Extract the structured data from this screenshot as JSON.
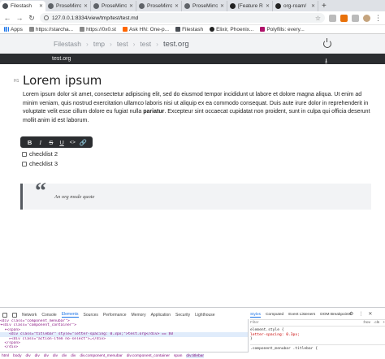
{
  "browser": {
    "tabs": [
      {
        "label": "Filestash",
        "active": true,
        "icon": "filestash-icon"
      },
      {
        "label": "ProseMirror",
        "active": false,
        "icon": "prosemirror-icon"
      },
      {
        "label": "ProseMirror",
        "active": false,
        "icon": "prosemirror-icon"
      },
      {
        "label": "ProseMirror",
        "active": false,
        "icon": "prosemirror-icon"
      },
      {
        "label": "ProseMirror",
        "active": false,
        "icon": "prosemirror-icon"
      },
      {
        "label": "[Feature Re",
        "active": false,
        "icon": "github-icon"
      },
      {
        "label": "org-roam/",
        "active": false,
        "icon": "github-icon"
      }
    ],
    "url": "127.0.0.1:8334/view/tmp/test/test.md",
    "bookmarks": [
      {
        "label": "Apps",
        "icon": "apps-grid-icon"
      },
      {
        "label": "https://starcha...",
        "icon": "page-icon"
      },
      {
        "label": "https://0x0.st",
        "icon": "page-icon"
      },
      {
        "label": "Ask HN: One-p...",
        "icon": "hackernews-icon"
      },
      {
        "label": "Filestash",
        "icon": "filestash-icon"
      },
      {
        "label": "Elixir, Phoenix...",
        "icon": "github-icon"
      },
      {
        "label": "Polyfills: every...",
        "icon": "polyfill-icon"
      }
    ]
  },
  "app": {
    "breadcrumb": [
      "Filestash",
      "tmp",
      "test",
      "test"
    ],
    "breadcrumb_separator": "›",
    "current_file": "test.org",
    "editor_filename": "test.org",
    "download_glyph": "⭳"
  },
  "document": {
    "h1_tag": "H1",
    "title": "Lorem ipsum",
    "paragraph_pre": "Lorem ipsum dolor sit amet, consectetur adipiscing elit, sed do eiusmod tempor incididunt ut labore et dolore magna aliqua. Ut enim ad minim veniam, quis nostrud exercitation ullamco laboris nisi ut aliquip ex ea commodo consequat. Duis aute irure dolor in reprehenderit in voluptate velit esse cillum dolore eu fugiat nulla ",
    "paragraph_bold": "pariatur",
    "paragraph_post": ". Excepteur sint occaecat cupidatat non proident, sunt in culpa qui officia deserunt mollit anim id est laborum.",
    "menubar": [
      {
        "glyph": "B",
        "name": "bold-button",
        "style": "bold"
      },
      {
        "glyph": "I",
        "name": "italic-button",
        "style": "italic"
      },
      {
        "glyph": "S",
        "name": "strikethrough-button",
        "style": "strike"
      },
      {
        "glyph": "U",
        "name": "underline-button",
        "style": "under"
      },
      {
        "glyph": "<>",
        "name": "code-button",
        "style": "code"
      },
      {
        "glyph": "🔗",
        "name": "link-button",
        "style": ""
      }
    ],
    "checklist": [
      "checklist 2",
      "checklist 3"
    ],
    "quote_mark": "“",
    "quote": "An org mode quote"
  },
  "devtools": {
    "tabs": [
      "Network",
      "Console",
      "Elements",
      "Sources",
      "Performance",
      "Memory",
      "Application",
      "Security",
      "Lighthouse"
    ],
    "active_tab": "Elements",
    "dom_lines": [
      "<div class=\"component_menubar\">",
      "▾<div class=\"component_container\">",
      "  ▾<span>",
      "    <div class=\"titlebar\" style=\"letter-spacing: 0.3px;\">test.org</div> == $0",
      "    ▸<div class=\"action-item no-select\">…</div>",
      "  </span>",
      "  </div>"
    ],
    "selected_line": 3,
    "breadcrumbs": [
      "html",
      "body",
      "div",
      "div",
      "div",
      "div",
      "div",
      "div",
      "div.component_menubar",
      "div.component_container",
      "span",
      "div.titlebar"
    ],
    "style_tabs": [
      "Styles",
      "Computed",
      "Event Listeners",
      "DOM Breakpoints"
    ],
    "filter_placeholder": "Filter",
    "filter_buttons": [
      ":hov",
      ".cls",
      "+"
    ],
    "rules": [
      "element.style {",
      "  letter-spacing: 0.3px;",
      "}",
      ".component_menubar .titlebar {"
    ]
  }
}
